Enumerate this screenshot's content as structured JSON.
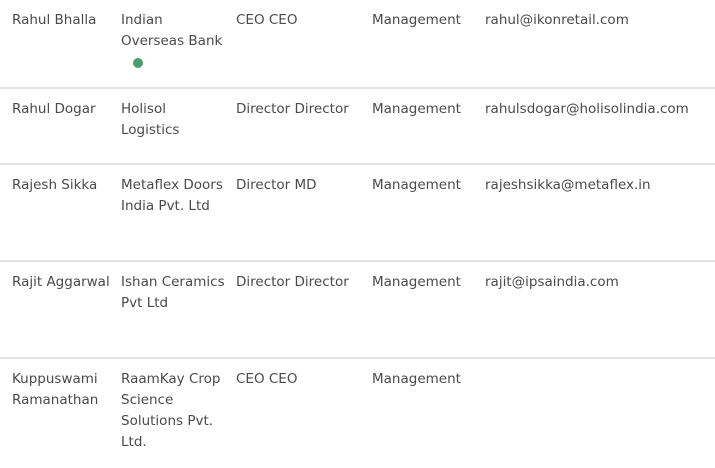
{
  "colors": {
    "online_status": "#4a9e6b",
    "divider": "#e2e2e2",
    "text": "#4a4a4a"
  },
  "contacts": [
    {
      "name": "Rahul Bhalla",
      "company": "Indian Overseas Bank",
      "title": "CEO CEO",
      "department": "Management",
      "email": "rahul@ikonretail.com",
      "online": true
    },
    {
      "name": "Rahul Dogar",
      "company": "Holisol Logistics",
      "title": "Director Director",
      "department": "Management",
      "email": "rahulsdogar@holisolindia.com",
      "online": false
    },
    {
      "name": "Rajesh Sikka",
      "company": "Metaflex Doors India Pvt. Ltd",
      "title": "Director MD",
      "department": "Management",
      "email": "rajeshsikka@metaflex.in",
      "online": false
    },
    {
      "name": "Rajit Aggarwal",
      "company": "Ishan Ceramics Pvt Ltd",
      "title": "Director Director",
      "department": "Management",
      "email": "rajit@ipsaindia.com",
      "online": false
    },
    {
      "name": "Kuppuswami Ramanathan",
      "company": "RaamKay Crop Science Solutions Pvt. Ltd.",
      "title": "CEO CEO",
      "department": "Management",
      "email": "",
      "online": false
    }
  ]
}
